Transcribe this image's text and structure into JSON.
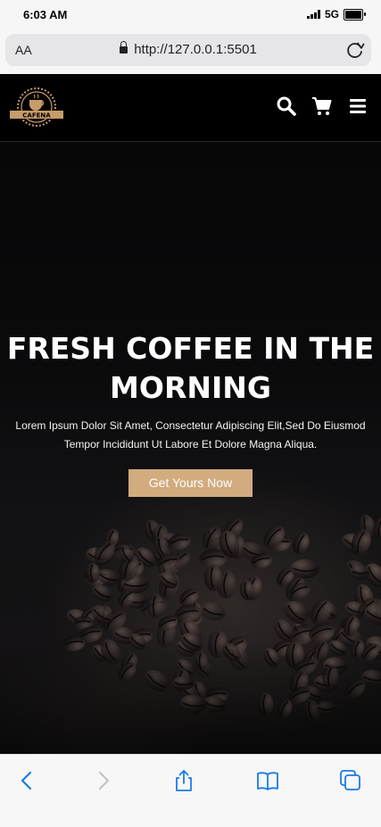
{
  "status_bar": {
    "time": "6:03 AM",
    "network": "5G"
  },
  "browser": {
    "text_size_label": "AA",
    "url": "http://127.0.0.1:5501"
  },
  "site": {
    "logo_text": "CAFENA",
    "hero": {
      "title_line1": "FRESH COFFEE IN THE",
      "title_line2": "MORNING",
      "description_line1": "Lorem Ipsum Dolor Sit Amet, Consectetur Adipiscing Elit,Sed Do Eiusmod",
      "description_line2": "Tempor Incididunt Ut Labore Et Dolore Magna Aliqua.",
      "cta_label": "Get Yours Now"
    }
  },
  "icons": {
    "header": [
      "search-icon",
      "cart-icon",
      "menu-icon"
    ],
    "toolbar": [
      "back-icon",
      "forward-icon",
      "share-icon",
      "bookmarks-icon",
      "tabs-icon"
    ]
  },
  "colors": {
    "accent": "#d2ab7e",
    "header_bg": "#000000",
    "toolbar_blue": "#1a7be6"
  }
}
